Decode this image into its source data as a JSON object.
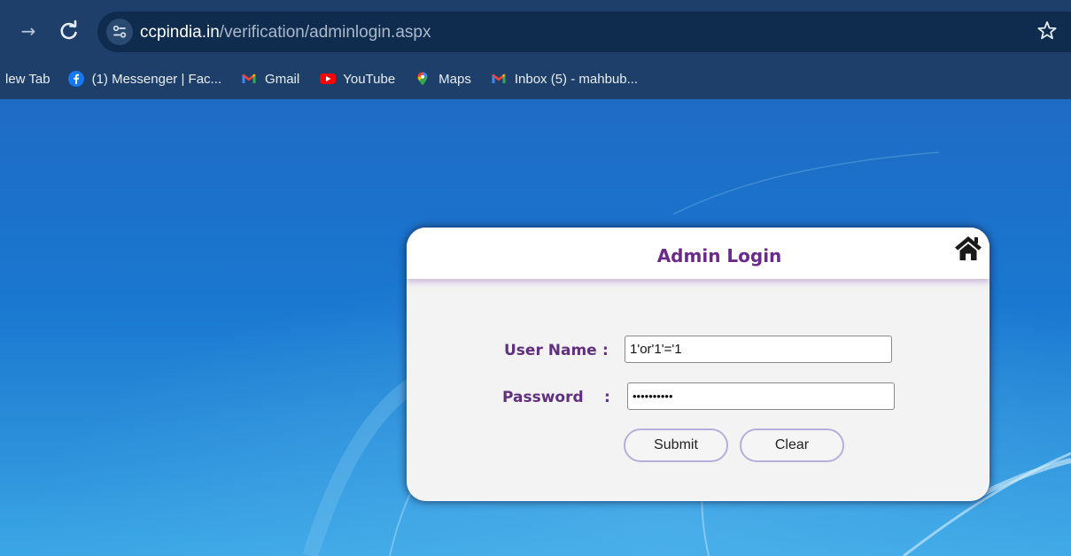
{
  "browser": {
    "url_host": "ccpindia.in",
    "url_path": "/verification/adminlogin.aspx",
    "bookmarks": [
      {
        "label": "lew Tab",
        "icon": "none"
      },
      {
        "label": "(1) Messenger | Fac...",
        "icon": "facebook-icon"
      },
      {
        "label": "Gmail",
        "icon": "gmail-icon"
      },
      {
        "label": "YouTube",
        "icon": "youtube-icon"
      },
      {
        "label": "Maps",
        "icon": "maps-icon"
      },
      {
        "label": "Inbox (5) - mahbub...",
        "icon": "gmail-icon"
      }
    ]
  },
  "login": {
    "title": "Admin Login",
    "username_label": "User Name",
    "password_label": "Password",
    "colon": ":",
    "username_value": "1'or'1'='1",
    "password_value": "1'or'1'='1",
    "submit_label": "Submit",
    "clear_label": "Clear"
  },
  "colors": {
    "chrome": "#1d3f6a",
    "page_blue": "#1a78d0",
    "title_purple": "#6a2a8c"
  }
}
